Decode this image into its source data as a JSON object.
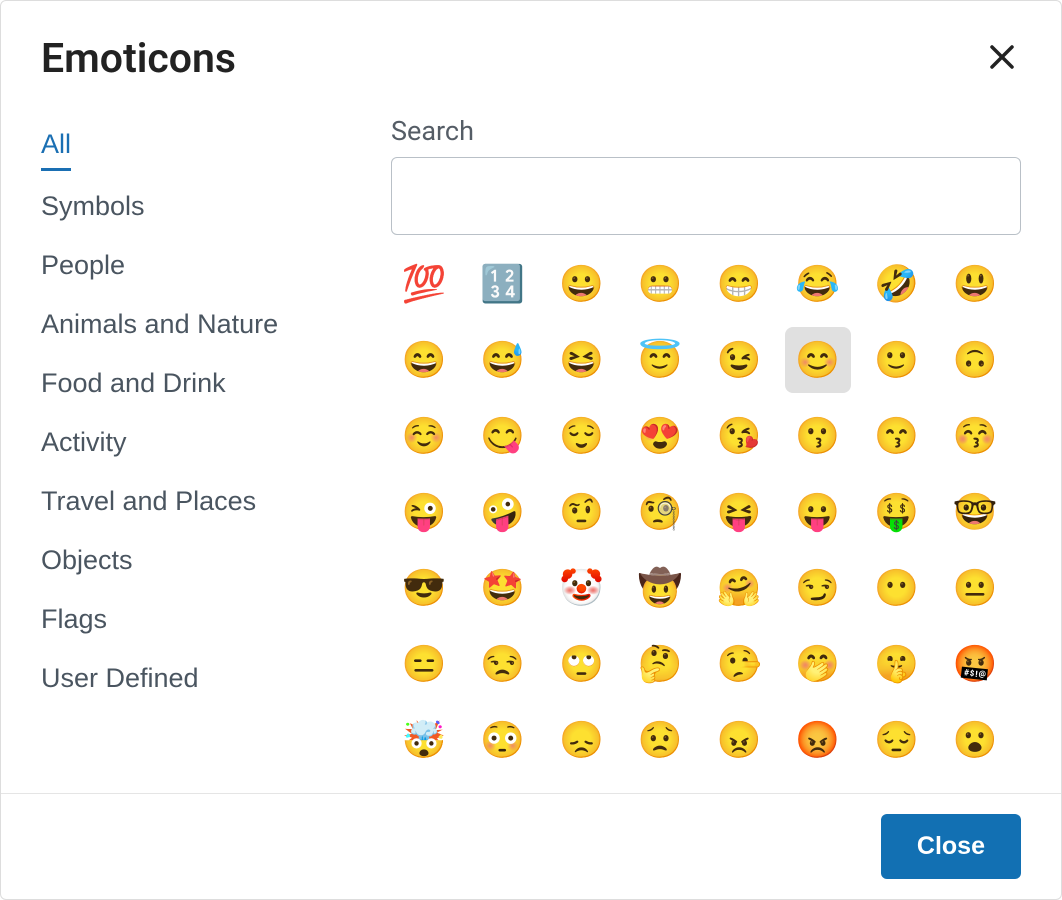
{
  "dialog": {
    "title": "Emoticons",
    "close_label": "Close"
  },
  "categories": [
    {
      "id": "all",
      "label": "All",
      "active": true
    },
    {
      "id": "symbols",
      "label": "Symbols",
      "active": false
    },
    {
      "id": "people",
      "label": "People",
      "active": false
    },
    {
      "id": "animals-nature",
      "label": "Animals and Nature",
      "active": false
    },
    {
      "id": "food-drink",
      "label": "Food and Drink",
      "active": false
    },
    {
      "id": "activity",
      "label": "Activity",
      "active": false
    },
    {
      "id": "travel-places",
      "label": "Travel and Places",
      "active": false
    },
    {
      "id": "objects",
      "label": "Objects",
      "active": false
    },
    {
      "id": "flags",
      "label": "Flags",
      "active": false
    },
    {
      "id": "user-defined",
      "label": "User Defined",
      "active": false
    }
  ],
  "search": {
    "label": "Search",
    "value": ""
  },
  "selected_emoji_index": 13,
  "emojis": [
    {
      "char": "💯",
      "name": "hundred-points"
    },
    {
      "char": "🔢",
      "name": "input-numbers"
    },
    {
      "char": "😀",
      "name": "grinning-face"
    },
    {
      "char": "😬",
      "name": "grimacing-face"
    },
    {
      "char": "😁",
      "name": "beaming-face"
    },
    {
      "char": "😂",
      "name": "face-with-tears-of-joy"
    },
    {
      "char": "🤣",
      "name": "rolling-on-the-floor-laughing"
    },
    {
      "char": "😃",
      "name": "grinning-face-big-eyes"
    },
    {
      "char": "😄",
      "name": "grinning-face-smiling-eyes"
    },
    {
      "char": "😅",
      "name": "grinning-face-sweat"
    },
    {
      "char": "😆",
      "name": "grinning-squinting-face"
    },
    {
      "char": "😇",
      "name": "smiling-face-halo"
    },
    {
      "char": "😉",
      "name": "winking-face"
    },
    {
      "char": "😊",
      "name": "smiling-face-smiling-eyes"
    },
    {
      "char": "🙂",
      "name": "slightly-smiling-face"
    },
    {
      "char": "🙃",
      "name": "upside-down-face"
    },
    {
      "char": "☺️",
      "name": "smiling-face"
    },
    {
      "char": "😋",
      "name": "face-savoring-food"
    },
    {
      "char": "😌",
      "name": "relieved-face"
    },
    {
      "char": "😍",
      "name": "smiling-face-heart-eyes"
    },
    {
      "char": "😘",
      "name": "face-blowing-kiss"
    },
    {
      "char": "😗",
      "name": "kissing-face"
    },
    {
      "char": "😙",
      "name": "kissing-face-smiling-eyes"
    },
    {
      "char": "😚",
      "name": "kissing-face-closed-eyes"
    },
    {
      "char": "😜",
      "name": "winking-face-tongue"
    },
    {
      "char": "🤪",
      "name": "zany-face"
    },
    {
      "char": "🤨",
      "name": "face-raised-eyebrow"
    },
    {
      "char": "🧐",
      "name": "face-monocle"
    },
    {
      "char": "😝",
      "name": "squinting-face-tongue"
    },
    {
      "char": "😛",
      "name": "face-tongue"
    },
    {
      "char": "🤑",
      "name": "money-mouth-face"
    },
    {
      "char": "🤓",
      "name": "nerd-face"
    },
    {
      "char": "😎",
      "name": "smiling-face-sunglasses"
    },
    {
      "char": "🤩",
      "name": "star-struck"
    },
    {
      "char": "🤡",
      "name": "clown-face"
    },
    {
      "char": "🤠",
      "name": "cowboy-hat-face"
    },
    {
      "char": "🤗",
      "name": "hugging-face"
    },
    {
      "char": "😏",
      "name": "smirking-face"
    },
    {
      "char": "😶",
      "name": "face-without-mouth"
    },
    {
      "char": "😐",
      "name": "neutral-face"
    },
    {
      "char": "😑",
      "name": "expressionless-face"
    },
    {
      "char": "😒",
      "name": "unamused-face"
    },
    {
      "char": "🙄",
      "name": "face-rolling-eyes"
    },
    {
      "char": "🤔",
      "name": "thinking-face"
    },
    {
      "char": "🤥",
      "name": "lying-face"
    },
    {
      "char": "🤭",
      "name": "face-hand-over-mouth"
    },
    {
      "char": "🤫",
      "name": "shushing-face"
    },
    {
      "char": "🤬",
      "name": "face-symbols-on-mouth"
    },
    {
      "char": "🤯",
      "name": "exploding-head"
    },
    {
      "char": "😳",
      "name": "flushed-face"
    },
    {
      "char": "😞",
      "name": "disappointed-face"
    },
    {
      "char": "😟",
      "name": "worried-face"
    },
    {
      "char": "😠",
      "name": "angry-face"
    },
    {
      "char": "😡",
      "name": "pouting-face"
    },
    {
      "char": "😔",
      "name": "pensive-face"
    },
    {
      "char": "😮",
      "name": "face-open-mouth"
    }
  ]
}
